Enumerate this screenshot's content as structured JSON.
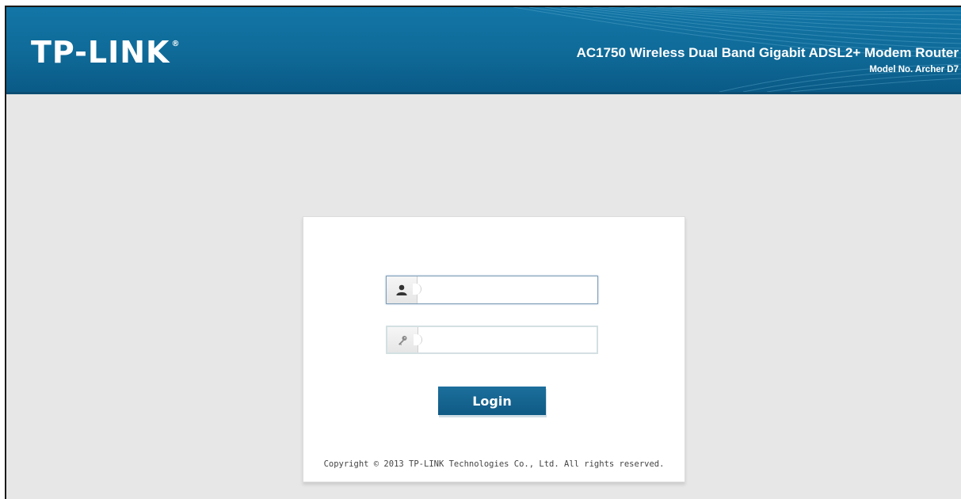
{
  "header": {
    "logo_text": "TP-LINK",
    "logo_mark": "®",
    "product_title": "AC1750 Wireless Dual Band Gigabit ADSL2+ Modem Router",
    "model": "Model No. Archer D7"
  },
  "login": {
    "username": {
      "icon": "user-icon",
      "value": ""
    },
    "password": {
      "icon": "key-icon",
      "value": ""
    },
    "button_label": "Login"
  },
  "footer": {
    "copyright": "Copyright © 2013 TP-LINK Technologies Co., Ltd. All rights reserved."
  },
  "colors": {
    "header_blue": "#0f6a98",
    "button_blue": "#155f8a",
    "page_background": "#e7e7e7"
  }
}
